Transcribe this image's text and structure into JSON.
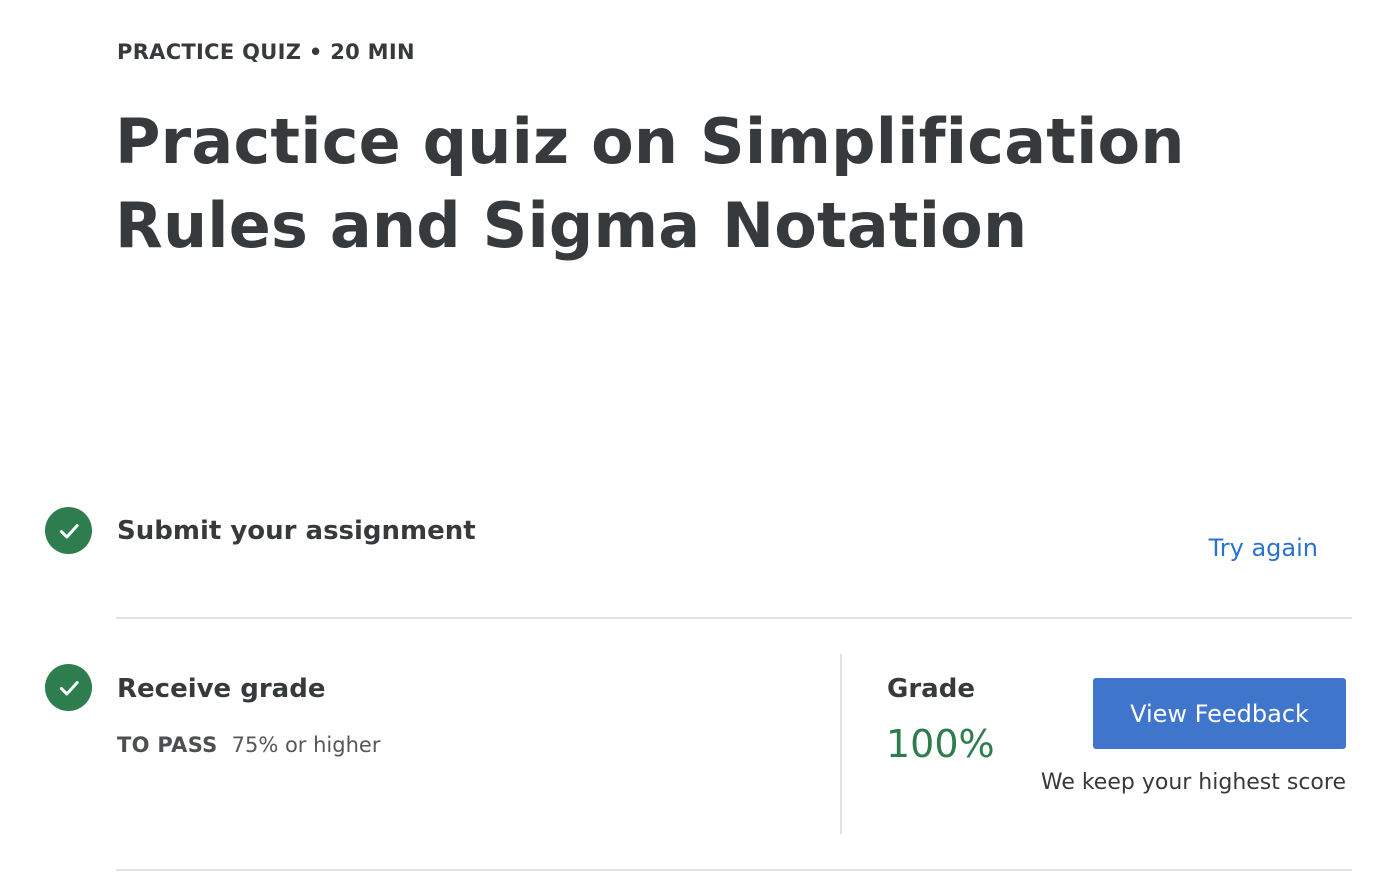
{
  "header": {
    "eyebrow": "PRACTICE QUIZ • 20 MIN",
    "title": "Practice quiz on Simplification Rules and Sigma Notation"
  },
  "steps": {
    "submit": {
      "label": "Submit your assignment",
      "icon": "check-circle-icon",
      "action_label": "Try again"
    },
    "grade": {
      "label": "Receive grade",
      "icon": "check-circle-icon",
      "pass_key": "TO PASS",
      "pass_value": "75% or higher",
      "grade_label": "Grade",
      "grade_value": "100%",
      "button_label": "View Feedback",
      "note": "We keep your highest score"
    }
  },
  "colors": {
    "success": "#2e7d4f",
    "link": "#2a73cc",
    "button": "#3f76cc",
    "text": "#373a3c",
    "divider": "#e1e1e1"
  }
}
